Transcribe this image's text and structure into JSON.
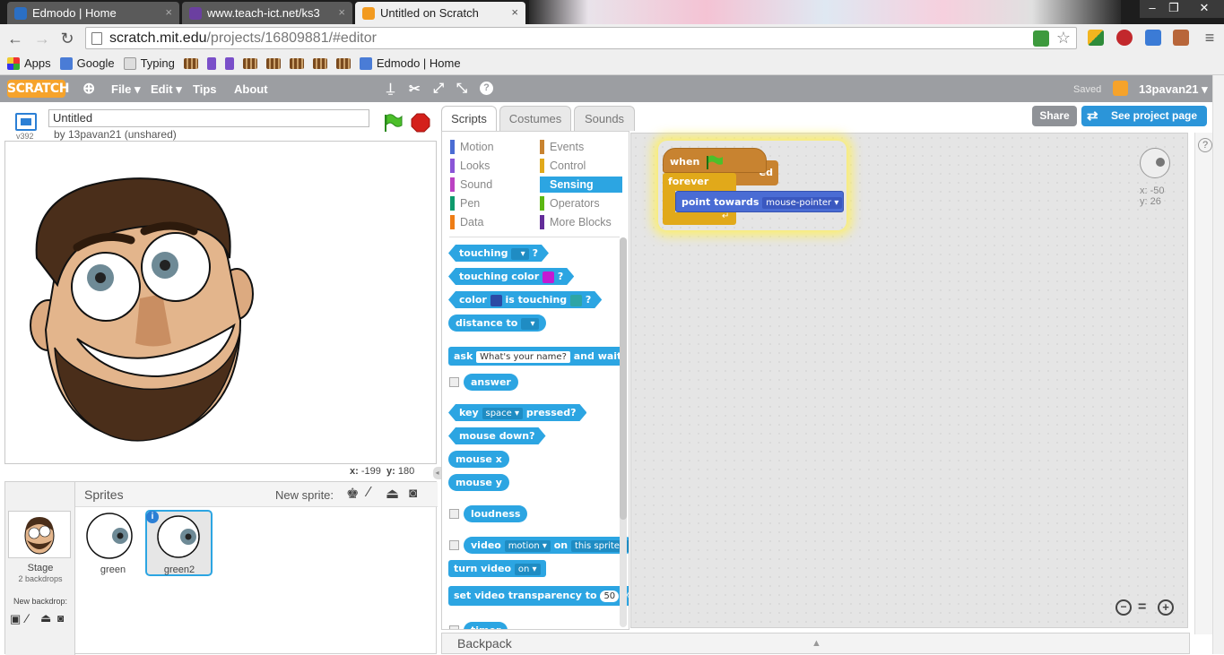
{
  "browser": {
    "tabs": [
      {
        "title": "Edmodo | Home",
        "close": "×"
      },
      {
        "title": "www.teach-ict.net/ks3",
        "close": "×"
      },
      {
        "title": "Untitled on Scratch",
        "close": "×"
      }
    ],
    "url_host": "scratch.mit.edu",
    "url_path": "/projects/16809881/#editor",
    "bookmarks": {
      "apps": "Apps",
      "google": "Google",
      "typing": "Typing",
      "edmodo": "Edmodo | Home"
    }
  },
  "menubar": {
    "logo": "SCRATCH",
    "file": "File",
    "edit": "Edit",
    "tips": "Tips",
    "about": "About",
    "saved": "Saved",
    "username": "13pavan21"
  },
  "project": {
    "title": "Untitled",
    "byline": "by 13pavan21 (unshared)",
    "version": "v392",
    "share": "Share",
    "see_project_page": "See project page"
  },
  "stage": {
    "mouse_x_label": "x:",
    "mouse_x": "-199",
    "mouse_y_label": "y:",
    "mouse_y": "180"
  },
  "sprites": {
    "header": "Sprites",
    "new_sprite": "New sprite:",
    "stage_label": "Stage",
    "backdrops": "2 backdrops",
    "new_backdrop": "New backdrop:",
    "items": [
      {
        "name": "green"
      },
      {
        "name": "green2"
      }
    ]
  },
  "editor_tabs": {
    "scripts": "Scripts",
    "costumes": "Costumes",
    "sounds": "Sounds"
  },
  "categories": {
    "motion": "Motion",
    "looks": "Looks",
    "sound": "Sound",
    "pen": "Pen",
    "data": "Data",
    "events": "Events",
    "control": "Control",
    "sensing": "Sensing",
    "operators": "Operators",
    "more": "More Blocks"
  },
  "colors": {
    "motion": "#4a6cd4",
    "looks": "#8a55d7",
    "sound": "#bb42c3",
    "pen": "#0e9a6c",
    "data": "#ee7d16",
    "events": "#c88330",
    "control": "#e1a91a",
    "sensing": "#2ca5e2",
    "operators": "#5cb712",
    "more": "#632d99"
  },
  "blocks": {
    "touching": "touching",
    "q": "?",
    "touching_color": "touching color",
    "color": "color",
    "is_touching": "is touching",
    "distance_to": "distance to",
    "ask": "ask",
    "ask_default": "What's your name?",
    "and_wait": "and wait",
    "answer": "answer",
    "key": "key",
    "key_default": "space",
    "pressed": "pressed?",
    "mouse_down": "mouse down?",
    "mouse_x": "mouse x",
    "mouse_y": "mouse y",
    "loudness": "loudness",
    "video": "video",
    "video_motion": "motion",
    "on": "on",
    "this_sprite": "this sprite",
    "turn_video": "turn video",
    "turn_video_on": "on",
    "set_video_transparency": "set video transparency to",
    "transparency_value": "50",
    "percent": "%",
    "timer": "timer"
  },
  "script": {
    "when": "when",
    "clicked": "clicked",
    "clicked_behind": "ed",
    "forever": "forever",
    "point_towards": "point towards",
    "target": "mouse-pointer"
  },
  "sprite_info": {
    "x_label": "x:",
    "x": "-50",
    "y_label": "y:",
    "y": "26"
  },
  "backpack": "Backpack"
}
